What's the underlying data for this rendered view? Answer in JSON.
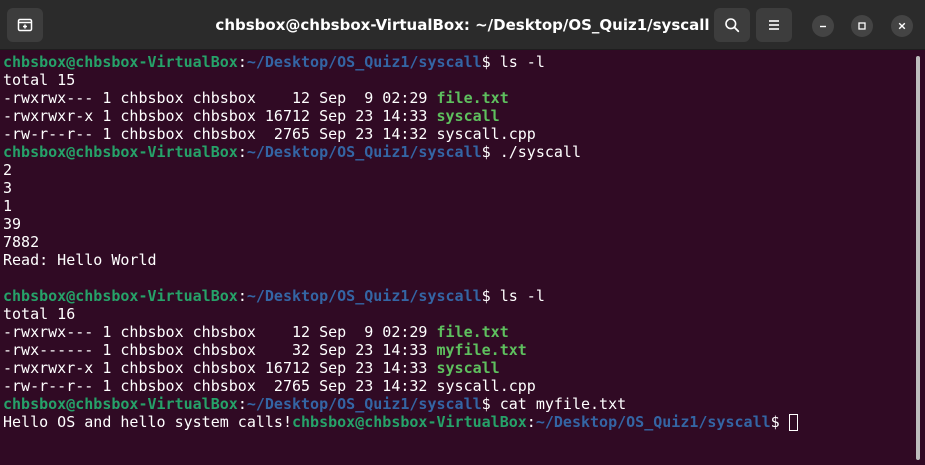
{
  "window": {
    "title": "chbsbox@chbsbox-VirtualBox: ~/Desktop/OS_Quiz1/syscall",
    "icons": {
      "new_tab": "new-tab-icon",
      "search": "search-icon",
      "menu": "hamburger-menu-icon",
      "minimize": "minimize-icon",
      "maximize": "maximize-icon",
      "close": "close-icon"
    }
  },
  "prompt": {
    "user": "chbsbox@chbsbox-VirtualBox",
    "path": "~/Desktop/OS_Quiz1/syscall",
    "symbol": "$"
  },
  "terminal": {
    "lines": [
      {
        "kind": "prompt",
        "cmd": " ls -l"
      },
      {
        "kind": "text",
        "text": "total 15"
      },
      {
        "kind": "file",
        "prefix": "-rwxrwx--- 1 chbsbox chbsbox    12 Sep  9 02:29 ",
        "name": "file.txt",
        "exec": true
      },
      {
        "kind": "file",
        "prefix": "-rwxrwxr-x 1 chbsbox chbsbox 16712 Sep 23 14:33 ",
        "name": "syscall",
        "exec": true
      },
      {
        "kind": "file",
        "prefix": "-rw-r--r-- 1 chbsbox chbsbox  2765 Sep 23 14:32 ",
        "name": "syscall.cpp",
        "exec": false
      },
      {
        "kind": "prompt",
        "cmd": " ./syscall"
      },
      {
        "kind": "text",
        "text": "2"
      },
      {
        "kind": "text",
        "text": "3"
      },
      {
        "kind": "text",
        "text": "1"
      },
      {
        "kind": "text",
        "text": "39"
      },
      {
        "kind": "text",
        "text": "7882"
      },
      {
        "kind": "text",
        "text": "Read: Hello World"
      },
      {
        "kind": "text",
        "text": ""
      },
      {
        "kind": "prompt",
        "cmd": " ls -l"
      },
      {
        "kind": "text",
        "text": "total 16"
      },
      {
        "kind": "file",
        "prefix": "-rwxrwx--- 1 chbsbox chbsbox    12 Sep  9 02:29 ",
        "name": "file.txt",
        "exec": true
      },
      {
        "kind": "file",
        "prefix": "-rwx------ 1 chbsbox chbsbox    32 Sep 23 14:33 ",
        "name": "myfile.txt",
        "exec": true
      },
      {
        "kind": "file",
        "prefix": "-rwxrwxr-x 1 chbsbox chbsbox 16712 Sep 23 14:33 ",
        "name": "syscall",
        "exec": true
      },
      {
        "kind": "file",
        "prefix": "-rw-r--r-- 1 chbsbox chbsbox  2765 Sep 23 14:32 ",
        "name": "syscall.cpp",
        "exec": false
      },
      {
        "kind": "prompt",
        "cmd": " cat myfile.txt"
      },
      {
        "kind": "final",
        "text": "Hello OS and hello system calls!",
        "cmd": " "
      }
    ]
  },
  "colors": {
    "background": "#300a24",
    "titlebar": "#2b2b2b",
    "prompt_user": "#26a269",
    "prompt_path": "#3465a4",
    "executable": "#5ec05e",
    "text": "#ffffff"
  }
}
